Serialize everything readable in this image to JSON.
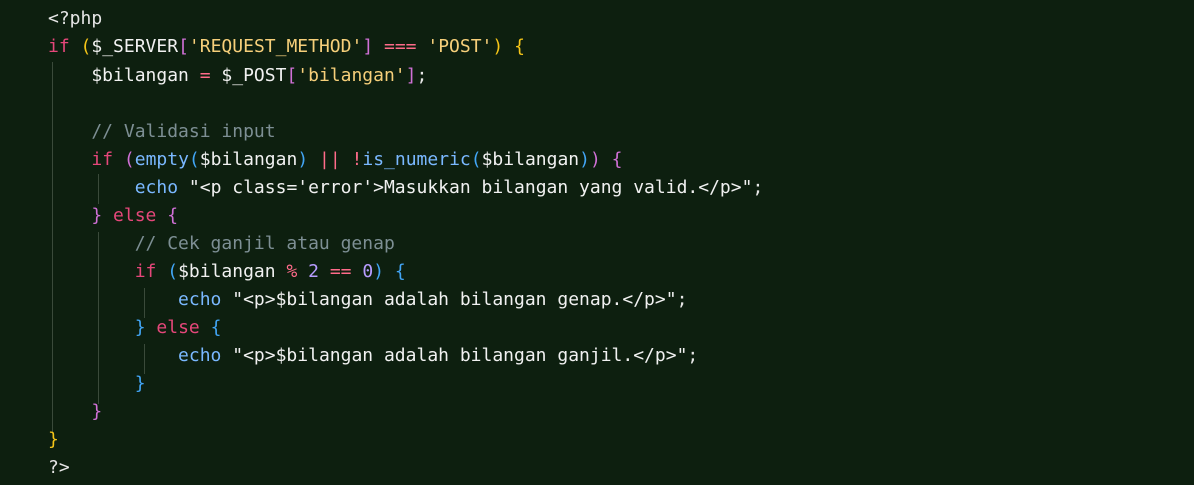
{
  "colors": {
    "background": "#0d1f0f",
    "keyword": "#e5477a",
    "builtin": "#7ab8ff",
    "string": "#f6cf7a",
    "comment": "#7d8f94",
    "bracket_level1": "#f5c518",
    "bracket_level2": "#d070d6",
    "bracket_level3": "#42a5f5",
    "number": "#b79cff",
    "indent_guide": "#3a4a3a"
  },
  "code": {
    "lines": [
      [
        {
          "t": "<?php",
          "c": "default"
        }
      ],
      [
        {
          "t": "if",
          "c": "keyword"
        },
        {
          "t": " ",
          "c": "default"
        },
        {
          "t": "(",
          "c": "bracket1"
        },
        {
          "t": "$_SERVER",
          "c": "variable"
        },
        {
          "t": "[",
          "c": "bracket2"
        },
        {
          "t": "'REQUEST_METHOD'",
          "c": "string"
        },
        {
          "t": "]",
          "c": "bracket2"
        },
        {
          "t": " ",
          "c": "default"
        },
        {
          "t": "===",
          "c": "operator"
        },
        {
          "t": " ",
          "c": "default"
        },
        {
          "t": "'POST'",
          "c": "string"
        },
        {
          "t": ")",
          "c": "bracket1"
        },
        {
          "t": " ",
          "c": "default"
        },
        {
          "t": "{",
          "c": "bracket1"
        }
      ],
      [
        {
          "t": "    $bilangan ",
          "c": "variable"
        },
        {
          "t": "=",
          "c": "operator"
        },
        {
          "t": " $_POST",
          "c": "variable"
        },
        {
          "t": "[",
          "c": "bracket2"
        },
        {
          "t": "'bilangan'",
          "c": "string"
        },
        {
          "t": "]",
          "c": "bracket2"
        },
        {
          "t": ";",
          "c": "default"
        }
      ],
      [
        {
          "t": "",
          "c": "default"
        }
      ],
      [
        {
          "t": "    // Validasi input",
          "c": "comment"
        }
      ],
      [
        {
          "t": "    ",
          "c": "default"
        },
        {
          "t": "if",
          "c": "keyword"
        },
        {
          "t": " ",
          "c": "default"
        },
        {
          "t": "(",
          "c": "bracket2"
        },
        {
          "t": "empty",
          "c": "builtin"
        },
        {
          "t": "(",
          "c": "bracket3"
        },
        {
          "t": "$bilangan",
          "c": "variable"
        },
        {
          "t": ")",
          "c": "bracket3"
        },
        {
          "t": " ",
          "c": "default"
        },
        {
          "t": "||",
          "c": "operator"
        },
        {
          "t": " ",
          "c": "default"
        },
        {
          "t": "!",
          "c": "operator"
        },
        {
          "t": "is_numeric",
          "c": "builtin"
        },
        {
          "t": "(",
          "c": "bracket3"
        },
        {
          "t": "$bilangan",
          "c": "variable"
        },
        {
          "t": ")",
          "c": "bracket3"
        },
        {
          "t": ")",
          "c": "bracket2"
        },
        {
          "t": " ",
          "c": "default"
        },
        {
          "t": "{",
          "c": "bracket2"
        }
      ],
      [
        {
          "t": "        ",
          "c": "default"
        },
        {
          "t": "echo",
          "c": "builtin"
        },
        {
          "t": " ",
          "c": "default"
        },
        {
          "t": "\"<p class='error'>Masukkan bilangan yang valid.</p>\"",
          "c": "tag"
        },
        {
          "t": ";",
          "c": "default"
        }
      ],
      [
        {
          "t": "    ",
          "c": "default"
        },
        {
          "t": "}",
          "c": "bracket2"
        },
        {
          "t": " ",
          "c": "default"
        },
        {
          "t": "else",
          "c": "keyword"
        },
        {
          "t": " ",
          "c": "default"
        },
        {
          "t": "{",
          "c": "bracket2"
        }
      ],
      [
        {
          "t": "        // Cek ganjil atau genap",
          "c": "comment"
        }
      ],
      [
        {
          "t": "        ",
          "c": "default"
        },
        {
          "t": "if",
          "c": "keyword"
        },
        {
          "t": " ",
          "c": "default"
        },
        {
          "t": "(",
          "c": "bracket3"
        },
        {
          "t": "$bilangan",
          "c": "variable"
        },
        {
          "t": " ",
          "c": "default"
        },
        {
          "t": "%",
          "c": "operator"
        },
        {
          "t": " ",
          "c": "default"
        },
        {
          "t": "2",
          "c": "number"
        },
        {
          "t": " ",
          "c": "default"
        },
        {
          "t": "==",
          "c": "operator"
        },
        {
          "t": " ",
          "c": "default"
        },
        {
          "t": "0",
          "c": "number"
        },
        {
          "t": ")",
          "c": "bracket3"
        },
        {
          "t": " ",
          "c": "default"
        },
        {
          "t": "{",
          "c": "bracket3"
        }
      ],
      [
        {
          "t": "            ",
          "c": "default"
        },
        {
          "t": "echo",
          "c": "builtin"
        },
        {
          "t": " ",
          "c": "default"
        },
        {
          "t": "\"<p>$bilangan adalah bilangan genap.</p>\"",
          "c": "tag"
        },
        {
          "t": ";",
          "c": "default"
        }
      ],
      [
        {
          "t": "        ",
          "c": "default"
        },
        {
          "t": "}",
          "c": "bracket3"
        },
        {
          "t": " ",
          "c": "default"
        },
        {
          "t": "else",
          "c": "keyword"
        },
        {
          "t": " ",
          "c": "default"
        },
        {
          "t": "{",
          "c": "bracket3"
        }
      ],
      [
        {
          "t": "            ",
          "c": "default"
        },
        {
          "t": "echo",
          "c": "builtin"
        },
        {
          "t": " ",
          "c": "default"
        },
        {
          "t": "\"<p>$bilangan adalah bilangan ganjil.</p>\"",
          "c": "tag"
        },
        {
          "t": ";",
          "c": "default"
        }
      ],
      [
        {
          "t": "        ",
          "c": "default"
        },
        {
          "t": "}",
          "c": "bracket3"
        }
      ],
      [
        {
          "t": "    ",
          "c": "default"
        },
        {
          "t": "}",
          "c": "bracket2"
        }
      ],
      [
        {
          "t": "}",
          "c": "bracket1"
        }
      ],
      [
        {
          "t": "?>",
          "c": "default"
        }
      ]
    ]
  }
}
